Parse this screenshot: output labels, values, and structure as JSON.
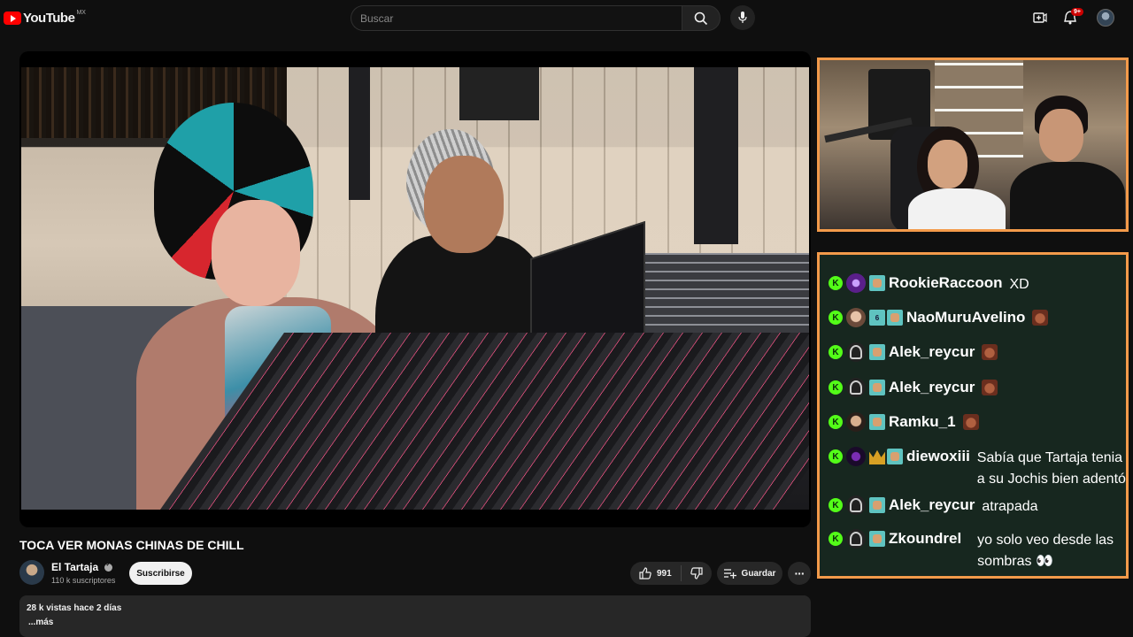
{
  "header": {
    "logo_text": "YouTube",
    "region": "MX",
    "search_placeholder": "Buscar",
    "notification_count": "9+"
  },
  "video": {
    "title": "TOCA VER MONAS CHINAS DE CHILL",
    "channel_name": "El Tartaja",
    "subscribers": "110 k suscriptores",
    "subscribe_label": "Suscribirse",
    "likes": "991",
    "save_label": "Guardar",
    "more_label": "···",
    "description_meta": "28 k vistas  hace 2 días",
    "description_more": "...más"
  },
  "chat": {
    "messages": [
      {
        "user": "RookieRaccoon",
        "text": "XD"
      },
      {
        "user": "NaoMuruAvelino",
        "text": ""
      },
      {
        "user": "Alek_reycur",
        "text": ""
      },
      {
        "user": "Alek_reycur",
        "text": ""
      },
      {
        "user": "Ramku_1",
        "text": ""
      },
      {
        "user": "diewoxiii",
        "text": "Sabía que Tartaja tenia a su Jochis bien adentó"
      },
      {
        "user": "Alek_reycur",
        "text": "atrapada"
      },
      {
        "user": "Zkoundrel",
        "text": "yo solo veo desde las sombras 👀"
      }
    ],
    "kick_badge": "K"
  },
  "colors": {
    "accent_orange": "#f39a4a",
    "kick_green": "#53fc18",
    "youtube_red": "#ff0000",
    "chat_bg": "#17271f"
  }
}
